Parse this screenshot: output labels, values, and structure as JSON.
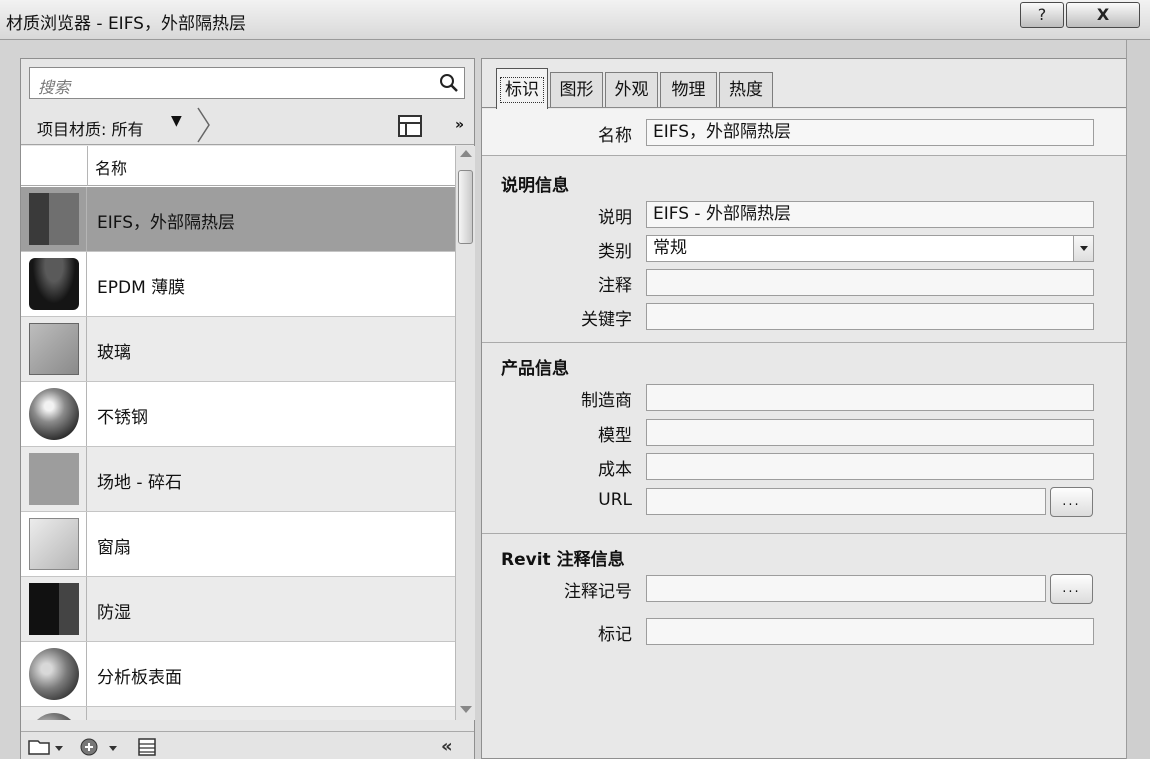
{
  "window": {
    "title": "材质浏览器 - EIFS，外部隔热层",
    "help_label": "?",
    "close_label": "X"
  },
  "left": {
    "search_placeholder": "搜索",
    "filter_label": "项目材质: 所有",
    "filter_arrow": "▼",
    "expand_label": "»",
    "column_header": "名称",
    "collapse_label": "«",
    "materials": [
      {
        "name": "EIFS，外部隔热层",
        "thumbnail": "facade"
      },
      {
        "name": "EPDM 薄膜",
        "thumbnail": "dark-cylinder"
      },
      {
        "name": "玻璃",
        "thumbnail": "glass"
      },
      {
        "name": "不锈钢",
        "thumbnail": "chrome-sphere"
      },
      {
        "name": "场地 - 碎石",
        "thumbnail": "gravel"
      },
      {
        "name": "窗扇",
        "thumbnail": "box"
      },
      {
        "name": "防湿",
        "thumbnail": "dark"
      },
      {
        "name": "分析板表面",
        "thumbnail": "sphere"
      }
    ]
  },
  "tabs": [
    "标识",
    "图形",
    "外观",
    "物理",
    "热度"
  ],
  "identity": {
    "name_label": "名称",
    "name_value": "EIFS，外部隔热层",
    "desc_section": "说明信息",
    "desc_label": "说明",
    "desc_value": "EIFS - 外部隔热层",
    "category_label": "类别",
    "category_value": "常规",
    "comment_label": "注释",
    "comment_value": "",
    "keywords_label": "关键字",
    "keywords_value": "",
    "product_section": "产品信息",
    "manufacturer_label": "制造商",
    "manufacturer_value": "",
    "model_label": "模型",
    "model_value": "",
    "cost_label": "成本",
    "cost_value": "",
    "url_label": "URL",
    "url_value": "",
    "browse_label": "...",
    "revit_section": "Revit 注释信息",
    "keynote_label": "注释记号",
    "keynote_value": "",
    "mark_label": "标记",
    "mark_value": ""
  }
}
